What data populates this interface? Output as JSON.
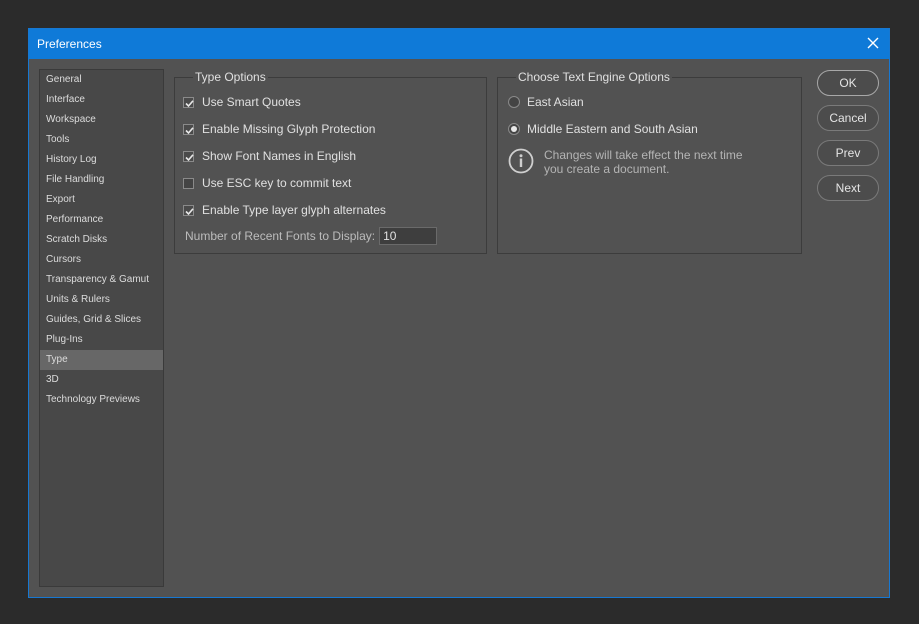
{
  "window": {
    "title": "Preferences"
  },
  "sidebar": {
    "items": [
      {
        "label": "General"
      },
      {
        "label": "Interface"
      },
      {
        "label": "Workspace"
      },
      {
        "label": "Tools"
      },
      {
        "label": "History Log"
      },
      {
        "label": "File Handling"
      },
      {
        "label": "Export"
      },
      {
        "label": "Performance"
      },
      {
        "label": "Scratch Disks"
      },
      {
        "label": "Cursors"
      },
      {
        "label": "Transparency & Gamut"
      },
      {
        "label": "Units & Rulers"
      },
      {
        "label": "Guides, Grid & Slices"
      },
      {
        "label": "Plug-Ins"
      },
      {
        "label": "Type"
      },
      {
        "label": "3D"
      },
      {
        "label": "Technology Previews"
      }
    ],
    "selected": "Type"
  },
  "type_options": {
    "legend": "Type Options",
    "checkboxes": [
      {
        "label": "Use Smart Quotes",
        "checked": true
      },
      {
        "label": "Enable Missing Glyph Protection",
        "checked": true
      },
      {
        "label": "Show Font Names in English",
        "checked": true
      },
      {
        "label": "Use ESC key to commit text",
        "checked": false
      },
      {
        "label": "Enable Type layer glyph alternates",
        "checked": true
      }
    ],
    "recent_fonts_label": "Number of Recent Fonts to Display:",
    "recent_fonts_value": "10"
  },
  "text_engine": {
    "legend": "Choose Text Engine Options",
    "options": [
      {
        "label": "East Asian",
        "selected": false
      },
      {
        "label": "Middle Eastern and South Asian",
        "selected": true
      }
    ],
    "info_line1": "Changes will take effect the next time",
    "info_line2": "you create a document."
  },
  "buttons": {
    "ok": "OK",
    "cancel": "Cancel",
    "prev": "Prev",
    "next": "Next"
  },
  "colors": {
    "titlebar": "#0f7ad8",
    "dialog_bg": "#525252",
    "selected_item": "#676767"
  },
  "icons": {
    "close": "close-icon",
    "info": "info-icon",
    "check": "checkmark-icon"
  }
}
